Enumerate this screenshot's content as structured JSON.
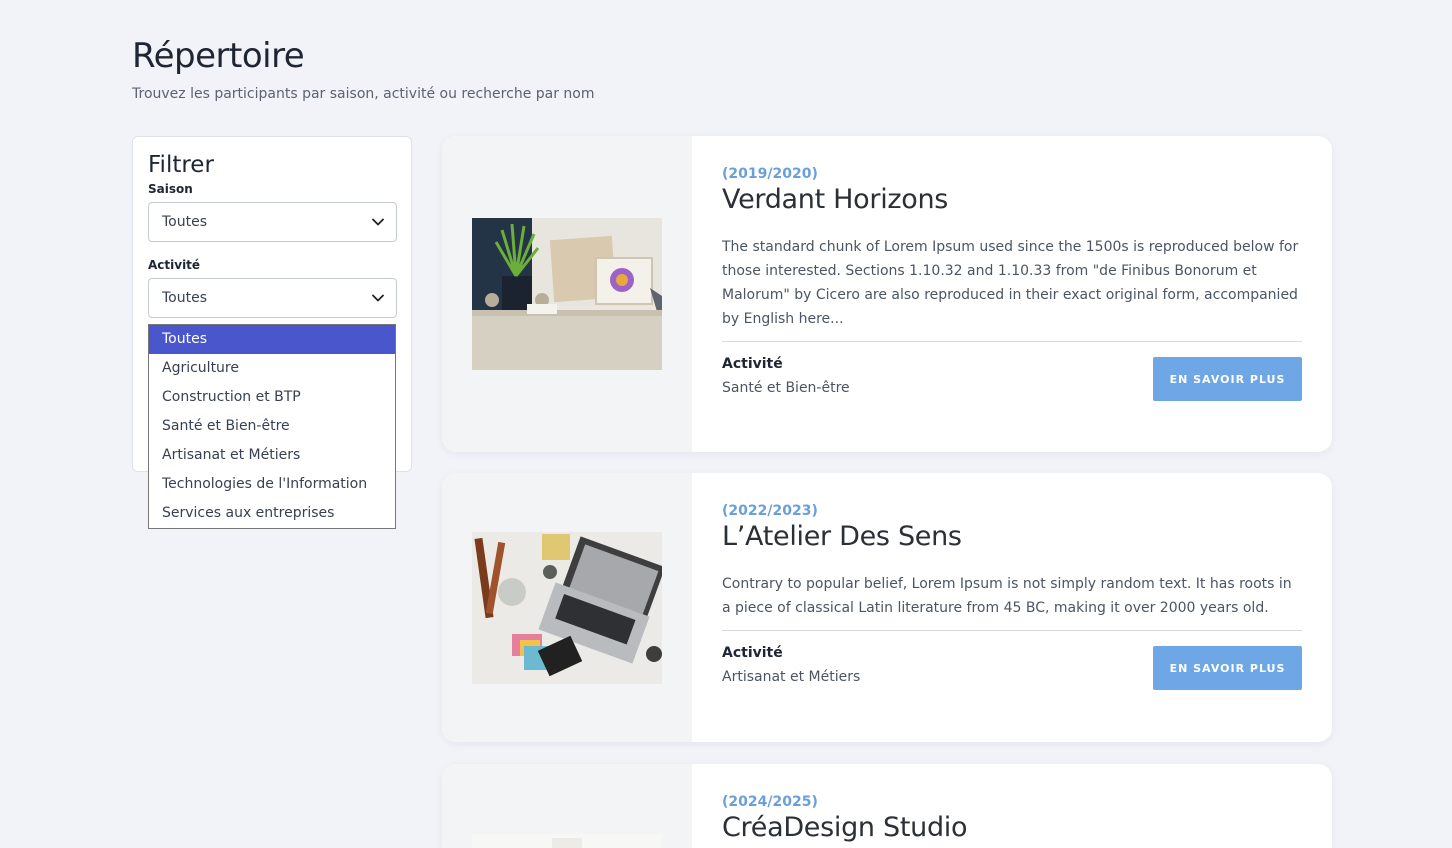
{
  "header": {
    "title": "Répertoire",
    "subtitle": "Trouvez les participants par saison, activité ou recherche par nom"
  },
  "filter": {
    "title": "Filtrer",
    "season_label": "Saison",
    "season_value": "Toutes",
    "activity_label": "Activité",
    "activity_value": "Toutes",
    "activity_options": [
      "Toutes",
      "Agriculture",
      "Construction et BTP",
      "Santé et Bien-être",
      "Artisanat et Métiers",
      "Technologies de l'Information",
      "Services aux entreprises"
    ]
  },
  "cards": [
    {
      "season": "(2019/2020)",
      "title": "Verdant Horizons",
      "description": "The standard chunk of Lorem Ipsum used since the 1500s is reproduced below for those interested. Sections 1.10.32 and 1.10.33 from \"de Finibus Bonorum et Malorum\" by Cicero are also reproduced in their exact original form, accompanied by English here...",
      "activity_label": "Activité",
      "activity": "Santé et Bien-être",
      "cta": "EN SAVOIR PLUS"
    },
    {
      "season": "(2022/2023)",
      "title": "L’Atelier Des Sens",
      "description": "Contrary to popular belief, Lorem Ipsum is not simply random text. It has roots in a piece of classical Latin literature from 45 BC, making it over 2000 years old.",
      "activity_label": "Activité",
      "activity": "Artisanat et Métiers",
      "cta": "EN SAVOIR PLUS"
    },
    {
      "season": "(2024/2025)",
      "title": "CréaDesign Studio"
    }
  ],
  "colors": {
    "accent_blue": "#6ea6e6",
    "season_blue": "#6a9fdc",
    "dropdown_selected": "#4a56cc",
    "page_background": "#f1f3f9"
  }
}
